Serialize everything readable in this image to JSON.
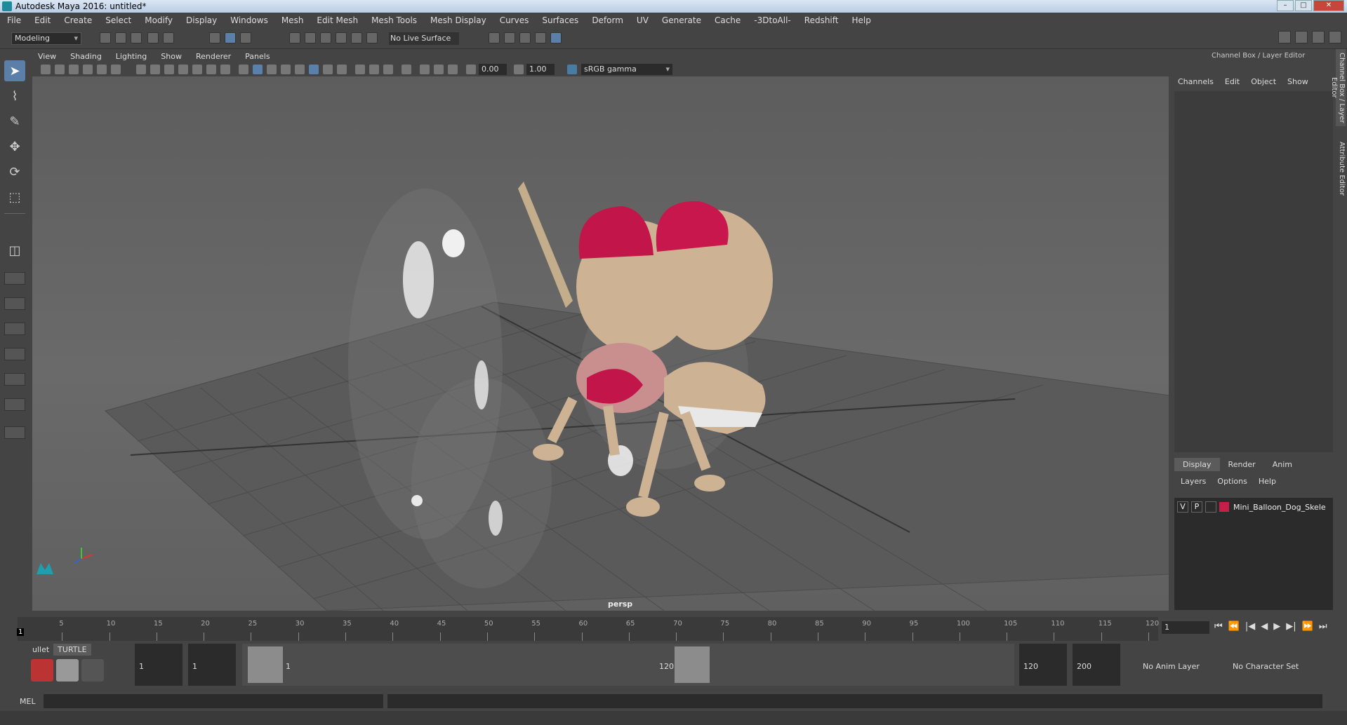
{
  "window": {
    "title": "Autodesk Maya 2016: untitled*"
  },
  "menu": [
    "File",
    "Edit",
    "Create",
    "Select",
    "Modify",
    "Display",
    "Windows",
    "Mesh",
    "Edit Mesh",
    "Mesh Tools",
    "Mesh Display",
    "Curves",
    "Surfaces",
    "Deform",
    "UV",
    "Generate",
    "Cache",
    "-3DtoAll-",
    "Redshift",
    "Help"
  ],
  "toolbar": {
    "mode": "Modeling",
    "live_surface": "No Live Surface"
  },
  "viewport": {
    "menu": [
      "View",
      "Shading",
      "Lighting",
      "Show",
      "Renderer",
      "Panels"
    ],
    "exposure": "0.00",
    "gamma": "1.00",
    "color_space": "sRGB gamma",
    "camera_label": "persp"
  },
  "channel_box": {
    "title": "Channel Box / Layer Editor",
    "menu": [
      "Channels",
      "Edit",
      "Object",
      "Show"
    ],
    "side_tabs": [
      "Channel Box / Layer Editor",
      "Attribute Editor"
    ]
  },
  "layer_editor": {
    "tabs": [
      "Display",
      "Render",
      "Anim"
    ],
    "menu": [
      "Layers",
      "Options",
      "Help"
    ],
    "layer": {
      "v": "V",
      "p": "P",
      "name": "Mini_Balloon_Dog_Skele",
      "color": "#c51e48"
    }
  },
  "timeline": {
    "ticks": [
      "5",
      "10",
      "15",
      "20",
      "25",
      "30",
      "35",
      "40",
      "45",
      "50",
      "55",
      "60",
      "65",
      "70",
      "75",
      "80",
      "85",
      "90",
      "95",
      "100",
      "105",
      "110",
      "115",
      "120"
    ],
    "current_marker": "1",
    "current_frame": "1"
  },
  "range": {
    "shelf_tabs": [
      "ullet",
      "TURTLE"
    ],
    "start": "1",
    "playback_start": "1",
    "slider_start": "1",
    "slider_end": "120",
    "playback_end": "120",
    "end": "200",
    "anim_layer": "No Anim Layer",
    "character_set": "No Character Set"
  },
  "command_line": {
    "label": "MEL"
  }
}
